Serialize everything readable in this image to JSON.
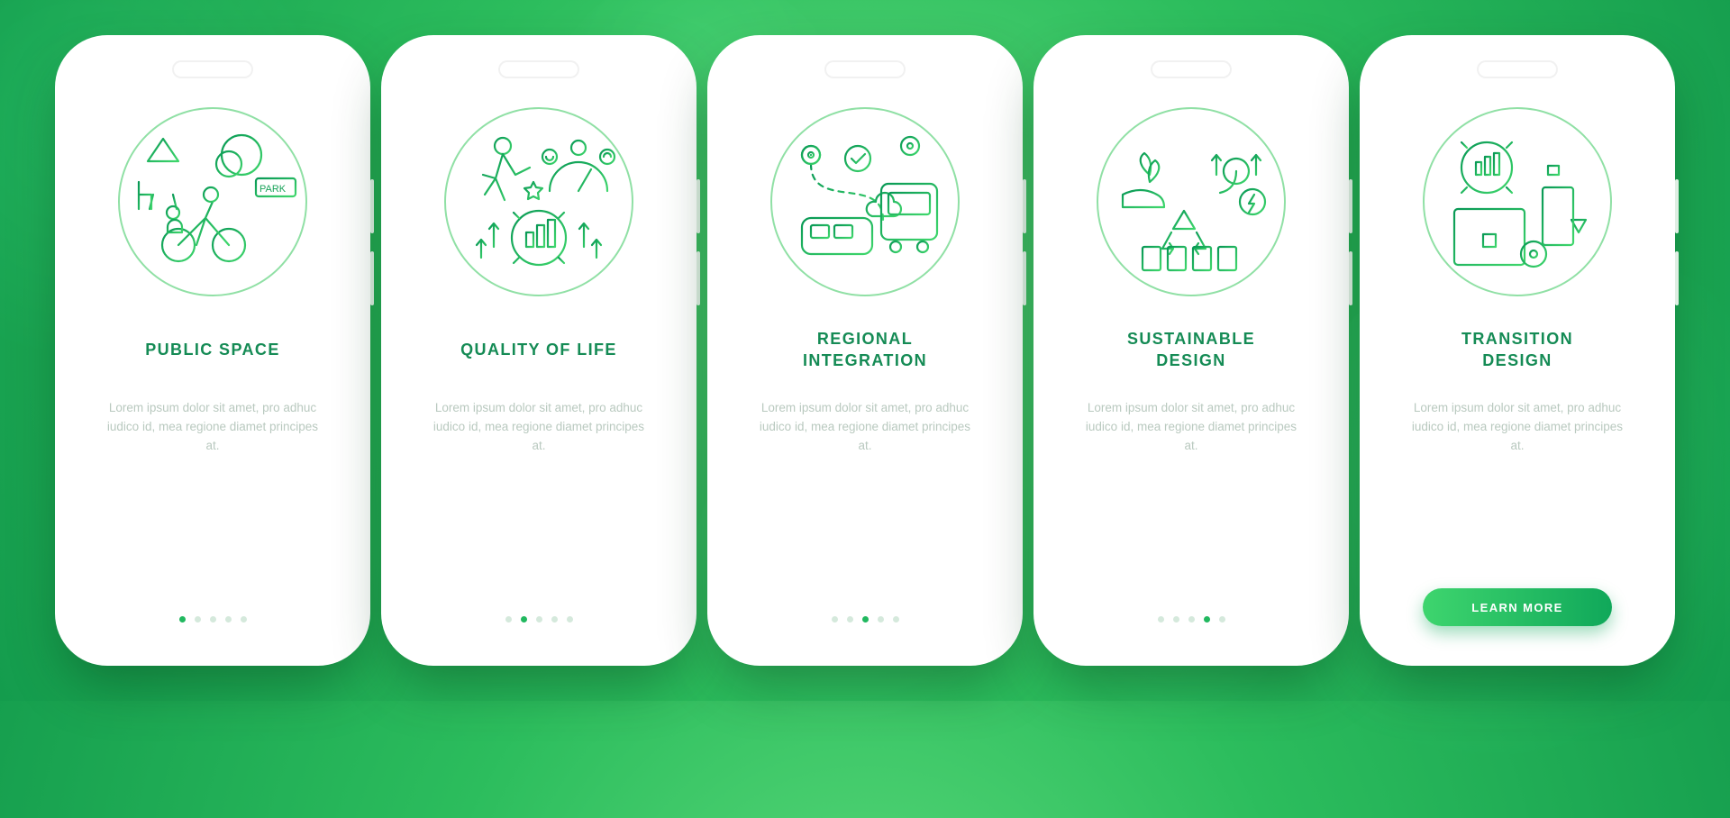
{
  "colors": {
    "accent_dark": "#0a8a4a",
    "accent_mid": "#21b85f",
    "accent_light": "#3fd76c"
  },
  "cta_label": "LEARN MORE",
  "dot_count": 5,
  "screens": [
    {
      "icon": "public-space-icon",
      "title": "PUBLIC SPACE",
      "description": "Lorem ipsum dolor sit amet, pro adhuc iudico id, mea regione diamet principes at.",
      "active_dot": 0,
      "show_cta": false
    },
    {
      "icon": "quality-of-life-icon",
      "title": "QUALITY OF LIFE",
      "description": "Lorem ipsum dolor sit amet, pro adhuc iudico id, mea regione diamet principes at.",
      "active_dot": 1,
      "show_cta": false
    },
    {
      "icon": "regional-integration-icon",
      "title": "REGIONAL\nINTEGRATION",
      "description": "Lorem ipsum dolor sit amet, pro adhuc iudico id, mea regione diamet principes at.",
      "active_dot": 2,
      "show_cta": false
    },
    {
      "icon": "sustainable-design-icon",
      "title": "SUSTAINABLE\nDESIGN",
      "description": "Lorem ipsum dolor sit amet, pro adhuc iudico id, mea regione diamet principes at.",
      "active_dot": 3,
      "show_cta": false
    },
    {
      "icon": "transition-design-icon",
      "title": "TRANSITION\nDESIGN",
      "description": "Lorem ipsum dolor sit amet, pro adhuc iudico id, mea regione diamet principes at.",
      "active_dot": 4,
      "show_cta": true
    }
  ],
  "illustration_labels": {
    "park_sign": "PARK"
  }
}
